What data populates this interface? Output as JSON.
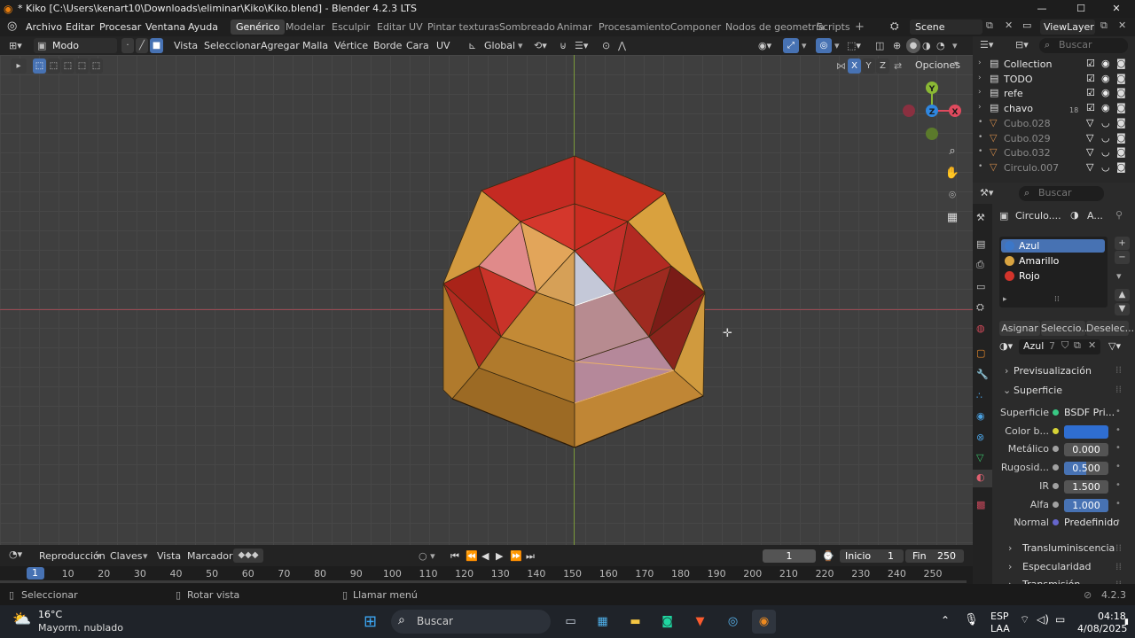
{
  "title_bar": {
    "title": "* Kiko [C:\\Users\\kenart10\\Downloads\\eliminar\\Kiko\\Kiko.blend] - Blender 4.2.3 LTS",
    "minimize": "—",
    "maximize": "☐",
    "close": "✕"
  },
  "menu": {
    "items": [
      "Archivo",
      "Editar",
      "Procesar",
      "Ventana",
      "Ayuda"
    ]
  },
  "workspaces": [
    "Genérico",
    "Modelar",
    "Esculpir",
    "Editar UV",
    "Pintar texturas",
    "Sombreado",
    "Animar",
    "Procesamiento",
    "Componer",
    "Nodos de geometría",
    "Scripts"
  ],
  "add_workspace": "+",
  "scene": {
    "label": "Scene",
    "view_layer": "ViewLayer"
  },
  "header": {
    "mode": "Modo Edición",
    "menus": [
      "Vista",
      "Seleccionar",
      "Agregar",
      "Malla",
      "Vértice",
      "Borde",
      "Cara",
      "UV"
    ],
    "transform_orientation": "Global"
  },
  "viewport": {
    "axes": {
      "x": "X",
      "y": "Y",
      "z": "Z"
    },
    "options": "Opciones",
    "gizmo": {
      "y": "Y",
      "z": "Z",
      "x": "X"
    }
  },
  "outliner": {
    "search_placeholder": "Buscar",
    "items": [
      {
        "name": "Collection",
        "dim": false
      },
      {
        "name": "TODO",
        "dim": false
      },
      {
        "name": "refe",
        "dim": false
      },
      {
        "name": "chavo",
        "dim": false,
        "badge": "18"
      },
      {
        "name": "Cubo.028",
        "dim": true
      },
      {
        "name": "Cubo.029",
        "dim": true
      },
      {
        "name": "Cubo.032",
        "dim": true
      },
      {
        "name": "Circulo.007",
        "dim": true
      }
    ]
  },
  "properties": {
    "search_placeholder": "Buscar",
    "breadcrumb_object": "Circulo....",
    "breadcrumb_material": "A...",
    "materials": [
      {
        "name": "Azul",
        "color": "#3c77c8",
        "selected": true
      },
      {
        "name": "Amarillo",
        "color": "#d9a441",
        "selected": false
      },
      {
        "name": "Rojo",
        "color": "#d2342b",
        "selected": false
      }
    ],
    "assign_buttons": [
      "Asignar",
      "Seleccio...",
      "Deselec..."
    ],
    "material_name": "Azul",
    "material_users": "7",
    "sections": {
      "preview": "Previsualización",
      "surface": "Superficie"
    },
    "surface_rows": [
      {
        "label": "Superficie",
        "value": "BSDF Pri...",
        "kind": "node"
      },
      {
        "label": "Color b...",
        "value": "",
        "kind": "color",
        "color": "#2f6ed1"
      },
      {
        "label": "Metálico",
        "value": "0.000",
        "kind": "slider",
        "fill": 0
      },
      {
        "label": "Rugosid...",
        "value": "0.500",
        "kind": "slider",
        "fill": 0.5
      },
      {
        "label": "IR",
        "value": "1.500",
        "kind": "slider",
        "fill": 0
      },
      {
        "label": "Alfa",
        "value": "1.000",
        "kind": "slider",
        "fill": 1
      },
      {
        "label": "Normal",
        "value": "Predefinido",
        "kind": "text"
      }
    ],
    "subsections": [
      "Transluminiscencia",
      "Especularidad",
      "Transmisión"
    ]
  },
  "timeline": {
    "menus": [
      "Reproducción",
      "Claves",
      "Vista",
      "Marcador"
    ],
    "current_frame": "1",
    "start_label": "Inicio",
    "start": "1",
    "end_label": "Fin",
    "end": "250",
    "ruler": [
      "1",
      "10",
      "20",
      "30",
      "40",
      "50",
      "60",
      "70",
      "80",
      "90",
      "100",
      "110",
      "120",
      "130",
      "140",
      "150",
      "160",
      "170",
      "180",
      "190",
      "200",
      "210",
      "220",
      "230",
      "240",
      "250"
    ]
  },
  "status_bar": {
    "select": "Seleccionar",
    "rotate": "Rotar vista",
    "menu": "Llamar menú",
    "version": "4.2.3"
  },
  "taskbar": {
    "weather_temp": "16°C",
    "weather_desc": "Mayorm. nublado",
    "search_placeholder": "Buscar",
    "language": "ESP",
    "region": "LAA",
    "time": "04:18",
    "date": "4/08/2025"
  }
}
